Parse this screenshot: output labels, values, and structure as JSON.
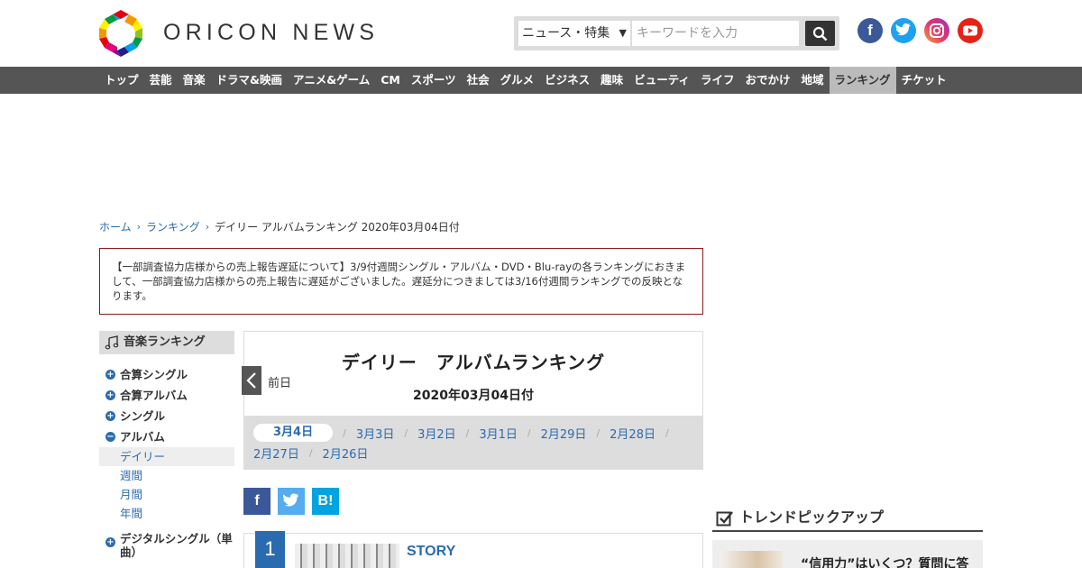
{
  "header": {
    "logo_text": "ORICON NEWS",
    "search": {
      "category": "ニュース・特集",
      "placeholder": "キーワードを入力"
    },
    "social": [
      "facebook-icon",
      "twitter-icon",
      "instagram-icon",
      "youtube-icon"
    ]
  },
  "nav": {
    "items": [
      "トップ",
      "芸能",
      "音楽",
      "ドラマ&映画",
      "アニメ&ゲーム",
      "CM",
      "スポーツ",
      "社会",
      "グルメ",
      "ビジネス",
      "趣味",
      "ビューティ",
      "ライフ",
      "おでかけ",
      "地域",
      "ランキング",
      "チケット"
    ],
    "active": "ランキング"
  },
  "breadcrumb": {
    "home": "ホーム",
    "ranking": "ランキング",
    "current": "デイリー アルバムランキング 2020年03月04日付"
  },
  "notice": "【一部調査協力店様からの売上報告遅延について】3/9付週間シングル・アルバム・DVD・Blu-rayの各ランキングにおきまして、一部調査協力店様からの売上報告に遅延がございました。遅延分につきましては3/16付週間ランキングでの反映となります。",
  "sidebar": {
    "heading": "音楽ランキング",
    "items": [
      {
        "label": "合算シングル",
        "toggle": "+"
      },
      {
        "label": "合算アルバム",
        "toggle": "+"
      },
      {
        "label": "シングル",
        "toggle": "+"
      },
      {
        "label": "アルバム",
        "toggle": "−"
      }
    ],
    "sub_items": [
      "デイリー",
      "週間",
      "月間",
      "年間"
    ],
    "digital": {
      "label": "デジタルシングル（単曲）",
      "toggle": "+"
    }
  },
  "ranking": {
    "title": "デイリー　アルバムランキング",
    "date": "2020年03月04日付",
    "prev_label": "前日",
    "dates_row1": [
      "3月4日",
      "3月3日",
      "3月2日",
      "3月1日",
      "2月29日",
      "2月28日"
    ],
    "dates_row2": [
      "2月27日",
      "2月26日"
    ],
    "active_date": "3月4日"
  },
  "share": {
    "fb": "f",
    "tw": "t",
    "hb": "B!"
  },
  "items": [
    {
      "rank": "1",
      "title": "STORY"
    }
  ],
  "trend": {
    "heading": "トレンドピックアップ",
    "card_text": "“信用力”はいくつ？質問に答"
  },
  "colors": {
    "nav_bg": "#555555",
    "link": "#2a6bb0",
    "notice_border": "#8b1a1a"
  }
}
